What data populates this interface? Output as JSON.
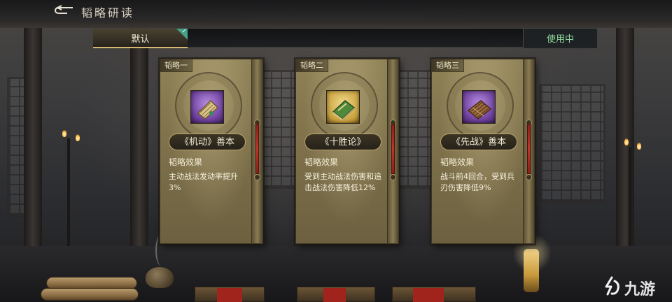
{
  "header": {
    "title": "韬略研读",
    "back_icon": "back-arrow-icon"
  },
  "tabs": {
    "default_label": "默认",
    "default_selected": true,
    "in_use_label": "使用中"
  },
  "cards": [
    {
      "tag": "韬略一",
      "book_name": "《机动》善本",
      "rarity_color": "#8b5ec0",
      "icon": "scroll-book-icon",
      "effect_title": "韬略效果",
      "effect_text": "主动战法发动率提升3%"
    },
    {
      "tag": "韬略二",
      "book_name": "《十胜论》",
      "rarity_color": "#d2aa48",
      "icon": "green-book-icon",
      "effect_title": "韬略效果",
      "effect_text": "受到主动战法伤害和追击战法伤害降低12%"
    },
    {
      "tag": "韬略三",
      "book_name": "《先战》善本",
      "rarity_color": "#8b5ec0",
      "icon": "bamboo-book-icon",
      "effect_title": "韬略效果",
      "effect_text": "战斗前4回合，受到兵刃伤害降低9%"
    }
  ],
  "watermark": {
    "text": "九游"
  }
}
